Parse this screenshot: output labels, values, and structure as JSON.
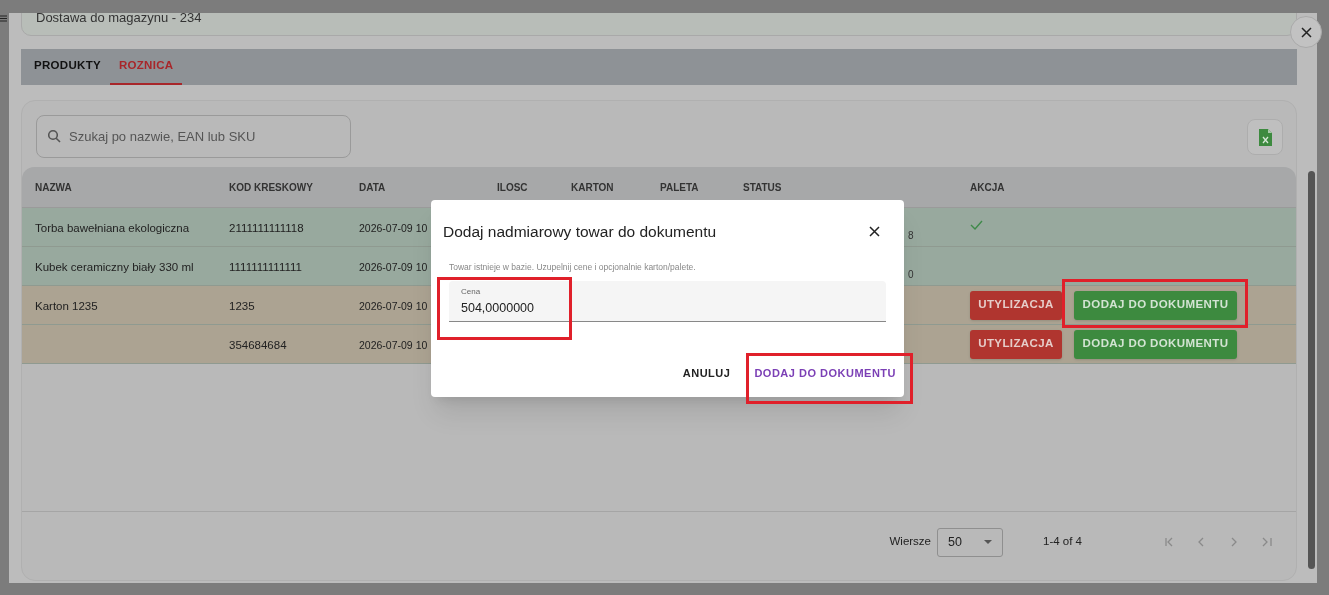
{
  "header": {
    "title": "Dostawa do magazynu - 234"
  },
  "tabs": [
    {
      "label": "PRODUKTY",
      "selected": false
    },
    {
      "label": "ROZNICA",
      "selected": true
    }
  ],
  "search": {
    "placeholder": "Szukaj po nazwie, EAN lub SKU"
  },
  "table": {
    "columns": [
      "NAZWA",
      "KOD KRESKOWY",
      "DATA",
      "ILOSC",
      "KARTON",
      "PALETA",
      "STATUS",
      "AKCJA"
    ],
    "rows": [
      {
        "kind": "matched",
        "name": "Torba bawełniana ekologiczna",
        "barcode": "2111111111118",
        "date": "2026-07-09 10",
        "status": "8",
        "done": true
      },
      {
        "kind": "matched",
        "name": "Kubek ceramiczny biały 330 ml",
        "barcode": "1111111111111",
        "date": "2026-07-09 10",
        "status": "0",
        "done": false
      },
      {
        "kind": "extra",
        "name": "Karton 1235",
        "barcode": "1235",
        "date": "2026-07-09 10",
        "done": false,
        "actions": [
          {
            "kind": "dispose",
            "label": "UTYLIZACJA"
          },
          {
            "kind": "add",
            "label": "DODAJ DO DOKUMENTU"
          }
        ]
      },
      {
        "kind": "extra",
        "barcode": "354684684",
        "date": "2026-07-09 10",
        "done": false,
        "actions": [
          {
            "kind": "dispose",
            "label": "UTYLIZACJA"
          },
          {
            "kind": "add",
            "label": "DODAJ DO DOKUMENTU"
          }
        ]
      }
    ]
  },
  "pagination": {
    "rows_label": "Wiersze",
    "per_page": "50",
    "range": "1-4 of 4"
  },
  "dialog": {
    "title": "Dodaj nadmiarowy towar do dokumentu",
    "hint": "Towar istnieje w bazie. Uzupelnij cene i opcjonalnie karton/palete.",
    "field": {
      "label": "Cena",
      "value": "504,0000000"
    },
    "buttons": [
      {
        "kind": "cancel",
        "label": "ANULUJ"
      },
      {
        "kind": "confirm",
        "label": "DODAJ DO DOKUMENTU"
      }
    ]
  }
}
